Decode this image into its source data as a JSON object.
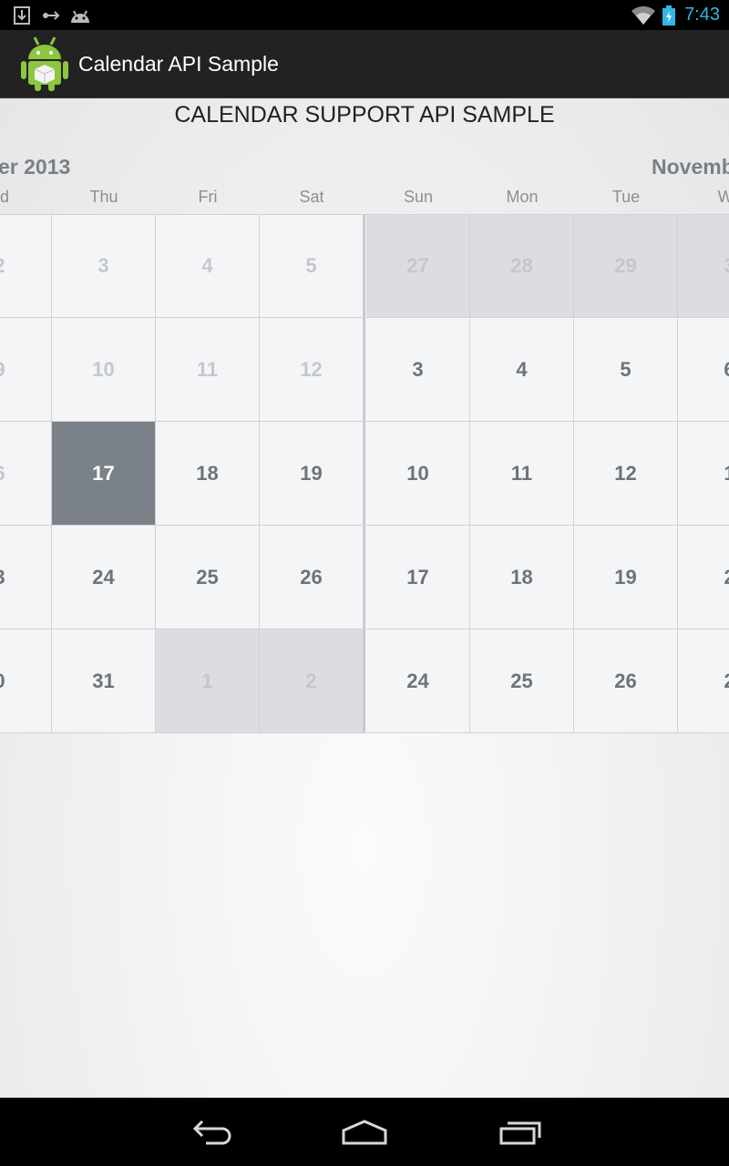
{
  "status_bar": {
    "time": "7:43",
    "icons": [
      "download-icon",
      "usb-debug-icon",
      "android-icon",
      "wifi-icon",
      "battery-charging-icon"
    ]
  },
  "action_bar": {
    "title": "Calendar API Sample",
    "icon": "android-app-icon"
  },
  "heading": "CALENDAR SUPPORT API SAMPLE",
  "months": {
    "left": "er 2013",
    "right": "Novemb"
  },
  "weekdays": [
    "ed",
    "Thu",
    "Fri",
    "Sat",
    "Sun",
    "Mon",
    "Tue",
    "We"
  ],
  "calendar_rows": [
    [
      "2",
      "3",
      "4",
      "5",
      "27",
      "28",
      "29",
      "3"
    ],
    [
      "9",
      "10",
      "11",
      "12",
      "3",
      "4",
      "5",
      "6"
    ],
    [
      "6",
      "17",
      "18",
      "19",
      "10",
      "11",
      "12",
      "1"
    ],
    [
      "3",
      "24",
      "25",
      "26",
      "17",
      "18",
      "19",
      "2"
    ],
    [
      "0",
      "31",
      "1",
      "2",
      "24",
      "25",
      "26",
      "2"
    ]
  ],
  "selected_date": "17",
  "navigation": {
    "buttons": [
      "back-icon",
      "home-icon",
      "recent-apps-icon"
    ]
  }
}
